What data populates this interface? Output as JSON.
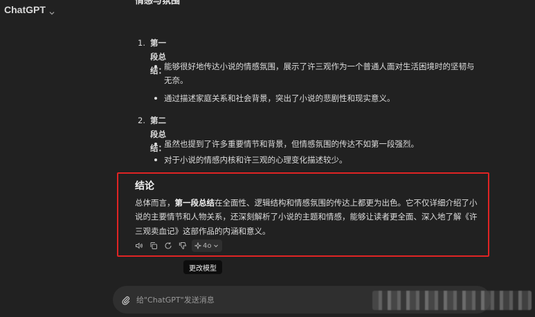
{
  "header": {
    "title": "ChatGPT"
  },
  "content": {
    "clipped_heading": "情感与氛围",
    "sections": [
      {
        "number": "1.",
        "label": "第一段总结：",
        "bullets": [
          "能够很好地传达小说的情感氛围，展示了许三观作为一个普通人面对生活困境时的坚韧与无奈。",
          "通过描述家庭关系和社会背景，突出了小说的悲剧性和现实意义。"
        ]
      },
      {
        "number": "2.",
        "label": "第二段总结：",
        "bullets": [
          "虽然也提到了许多重要情节和背景，但情感氛围的传达不如第一段强烈。",
          "对于小说的情感内核和许三观的心理变化描述较少。"
        ]
      }
    ],
    "conclusion": {
      "title": "结论",
      "text_before": "总体而言，",
      "text_bold": "第一段总结",
      "text_after": "在全面性、逻辑结构和情感氛围的传达上都更为出色。它不仅详细介绍了小说的主要情节和人物关系，还深刻解析了小说的主题和情感，能够让读者更全面、深入地了解《许三观卖血记》这部作品的内涵和意义。"
    }
  },
  "actions": {
    "model_label": "4o",
    "tooltip": "更改模型",
    "icons": [
      "speaker-icon",
      "copy-icon",
      "regenerate-icon",
      "thumbs-down-icon",
      "sparkle-icon"
    ]
  },
  "composer": {
    "placeholder": "给\"ChatGPT\"发送消息",
    "value": ""
  },
  "colors": {
    "background": "#212121",
    "composer": "#2f2f2f",
    "highlight_border": "#e02424",
    "text": "#dcdcdc"
  }
}
